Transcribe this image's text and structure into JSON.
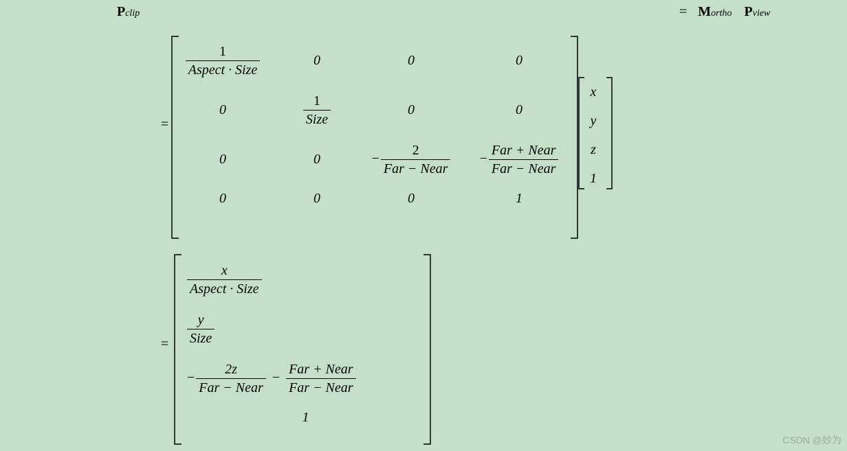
{
  "eq": {
    "lhs_P": "P",
    "lhs_sub": "clip",
    "rhs_eq": "=",
    "rhs_M": "M",
    "rhs_M_sub": "ortho",
    "rhs_P": "P",
    "rhs_P_sub": "view"
  },
  "line2_eq": "=",
  "M": {
    "r1c1_num": "1",
    "r1c1_den": "Aspect · Size",
    "r1c2": "0",
    "r1c3": "0",
    "r1c4": "0",
    "r2c1": "0",
    "r2c2_num": "1",
    "r2c2_den": "Size",
    "r2c3": "0",
    "r2c4": "0",
    "r3c1": "0",
    "r3c2": "0",
    "r3c3_neg": "−",
    "r3c3_num": "2",
    "r3c3_den": "Far − Near",
    "r3c4_neg": "−",
    "r3c4_num": "Far + Near",
    "r3c4_den": "Far − Near",
    "r4c1": "0",
    "r4c2": "0",
    "r4c3": "0",
    "r4c4": "1"
  },
  "vec": {
    "r1": "x",
    "r2": "y",
    "r3": "z",
    "r4": "1"
  },
  "line3_eq": "=",
  "R": {
    "r1_num": "x",
    "r1_den": "Aspect · Size",
    "r2_num": "y",
    "r2_den": "Size",
    "r3a_neg": "−",
    "r3a_num": "2z",
    "r3a_den": "Far − Near",
    "r3_minus": "−",
    "r3b_num": "Far + Near",
    "r3b_den": "Far − Near",
    "r4": "1"
  },
  "watermark": "CSDN @妙为"
}
